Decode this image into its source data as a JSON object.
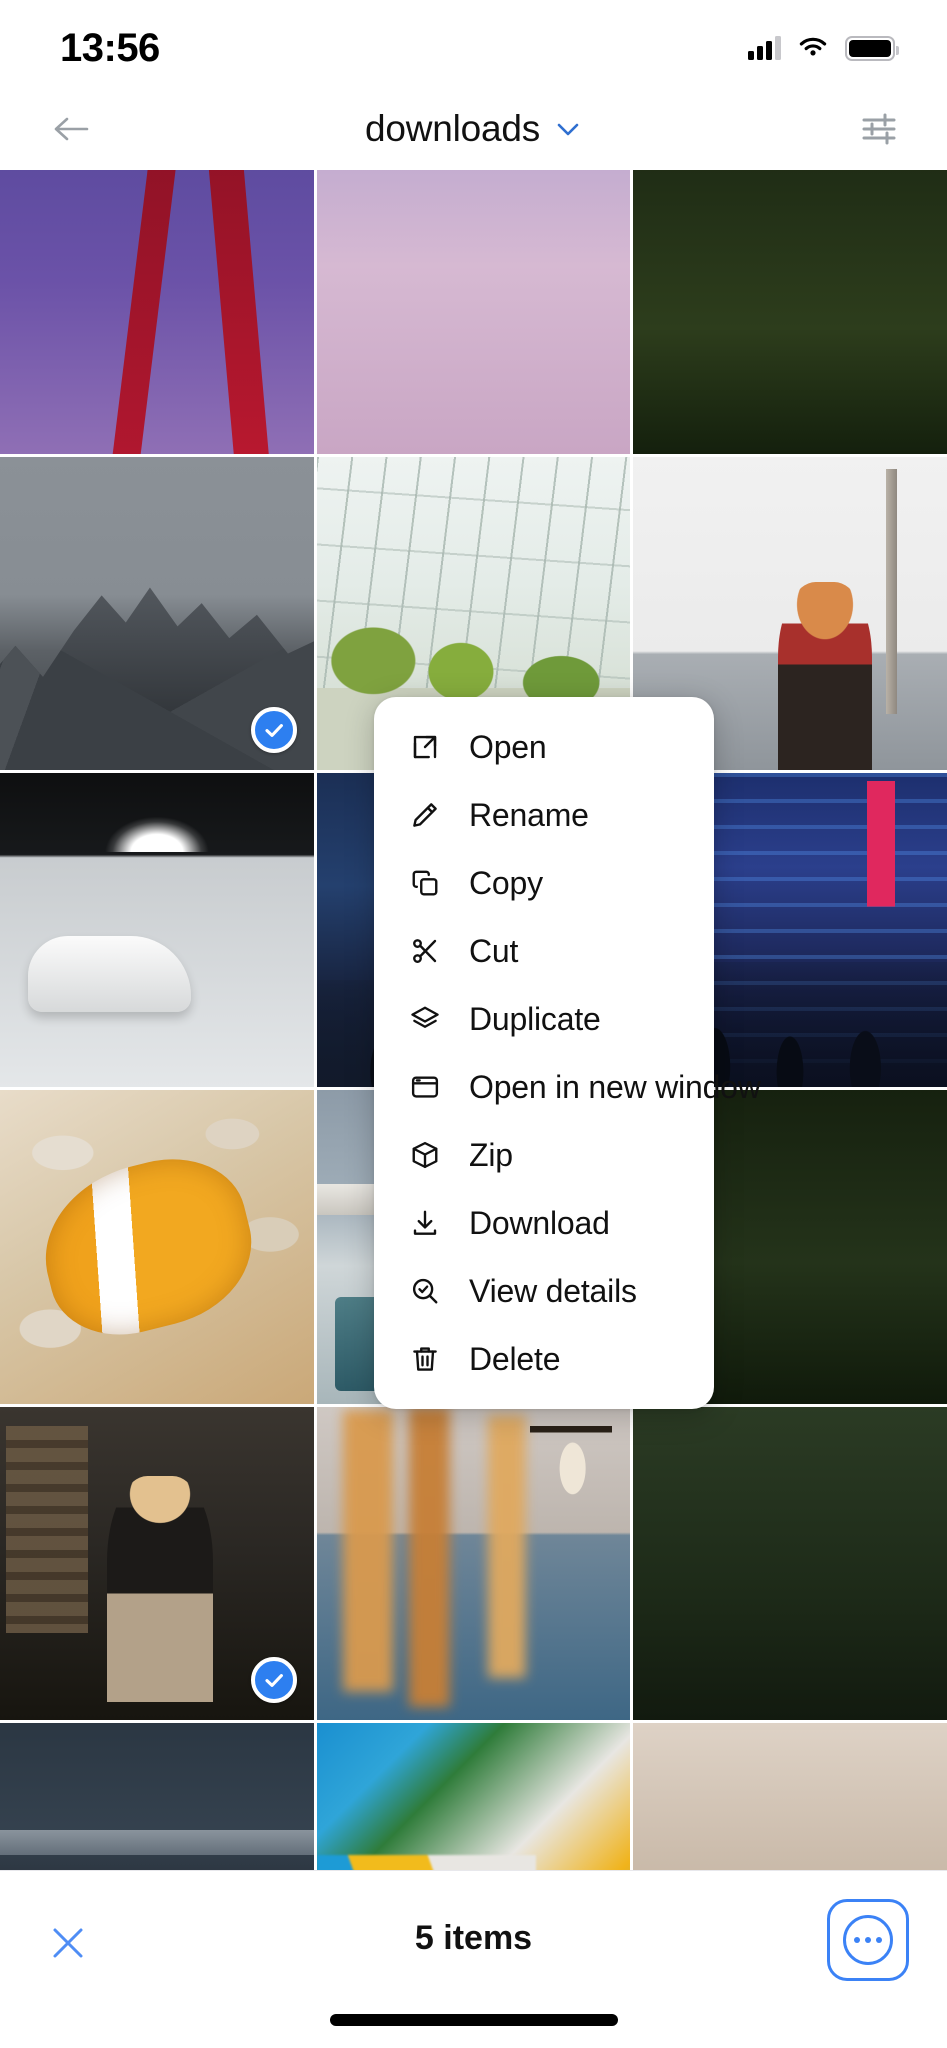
{
  "status_bar": {
    "time": "13:56",
    "cellular_icon": "cellular-signal-icon",
    "wifi_icon": "wifi-icon",
    "battery_icon": "battery-full-icon"
  },
  "nav_bar": {
    "back_icon": "arrow-left-icon",
    "title": "downloads",
    "dropdown_icon": "chevron-down-icon",
    "filter_icon": "sliders-icon"
  },
  "grid": {
    "columns": 3,
    "items": [
      {
        "art": "a-flagpurple",
        "alt": "purple sky with red flags",
        "selected": false
      },
      {
        "art": "a-pinkpool",
        "alt": "pink pastel pool surface",
        "selected": false
      },
      {
        "art": "a-treetop",
        "alt": "dark pine treetops",
        "selected": false
      },
      {
        "art": "a-mountain",
        "alt": "grey rocky mountain peaks",
        "selected": true
      },
      {
        "art": "a-greenhouse",
        "alt": "greenhouse with palms and cacti",
        "selected": false
      },
      {
        "art": "a-girlwall",
        "alt": "woman in red top by white wall",
        "selected": false
      },
      {
        "art": "a-carpark",
        "alt": "white sports car in car park",
        "selected": false
      },
      {
        "art": "a-tokyo1",
        "alt": "Tokyo Kabukicho neon street",
        "selected": false
      },
      {
        "art": "a-tokyo2",
        "alt": "Tokyo blue neon alley at night",
        "selected": false
      },
      {
        "art": "a-clownfish",
        "alt": "clownfish in anemone",
        "selected": false
      },
      {
        "art": "a-poolhouse",
        "alt": "modernist house with pool",
        "selected": false
      },
      {
        "art": "a-treetop2",
        "alt": "dark foliage",
        "selected": false
      },
      {
        "art": "a-woman",
        "alt": "woman sitting in dark room",
        "selected": true
      },
      {
        "art": "a-wheat",
        "alt": "blurred wheat stalks over water",
        "selected": false
      },
      {
        "art": "a-forest",
        "alt": "dark forest edge",
        "selected": false
      },
      {
        "art": "a-ship",
        "alt": "shipwreck on dark beach",
        "selected": true
      },
      {
        "art": "a-macaw",
        "alt": "blue and gold macaw close-up",
        "selected": false
      },
      {
        "art": "a-blurred",
        "alt": "soft blurred skin tones",
        "selected": false
      }
    ]
  },
  "context_menu": {
    "items": [
      {
        "label": "Open",
        "icon": "external-link-icon"
      },
      {
        "label": "Rename",
        "icon": "pencil-icon"
      },
      {
        "label": "Copy",
        "icon": "copy-icon"
      },
      {
        "label": "Cut",
        "icon": "scissors-icon"
      },
      {
        "label": "Duplicate",
        "icon": "layers-icon"
      },
      {
        "label": "Open in new window",
        "icon": "window-icon"
      },
      {
        "label": "Zip",
        "icon": "box-icon"
      },
      {
        "label": "Download",
        "icon": "download-icon"
      },
      {
        "label": "View details",
        "icon": "search-check-icon"
      },
      {
        "label": "Delete",
        "icon": "trash-icon"
      }
    ]
  },
  "bottom_bar": {
    "close_icon": "close-x-icon",
    "selection_count_label": "5 items",
    "more_icon": "ellipsis-circle-icon",
    "accent_color": "#3b82f6"
  },
  "colors": {
    "selection_blue": "#2d7ff0",
    "accent_blue": "#3b82f6",
    "menu_background": "#ffffff",
    "page_background": "#ffffff",
    "text_primary": "#111111",
    "icon_grey": "#9aa0a6"
  }
}
